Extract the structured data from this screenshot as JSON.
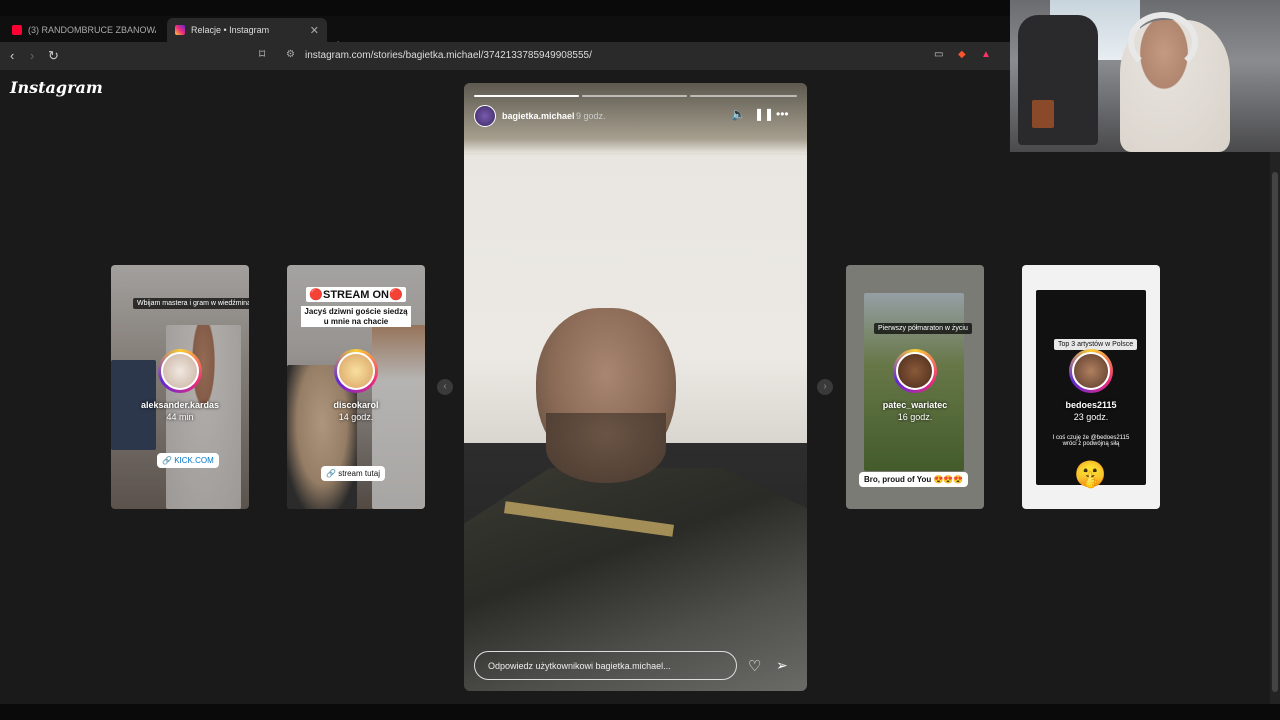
{
  "browser": {
    "tabs": [
      {
        "title": "(3) RANDOMBRUCE ZBANOWANY! Il",
        "favicon_color": "#ff0033"
      },
      {
        "title": "Relacje • Instagram",
        "favicon_color": "#e1306c"
      }
    ],
    "new_tab": "+",
    "url": "instagram.com/stories/bagietka.michael/3742133785949908555/"
  },
  "instagram": {
    "logo": "Instagram"
  },
  "main_story": {
    "username": "bagietka.michael",
    "time_ago": "9 godz.",
    "segments": 3,
    "reply_placeholder": "Odpowiedz użytkownikowi bagietka.michael..."
  },
  "side_stories": [
    {
      "username": "aleksander.kardas",
      "time_ago": "44 min",
      "sticker": "Wbijam mastera i gram w wiedźmina 3",
      "link": "KICK.COM"
    },
    {
      "username": "discokarol",
      "time_ago": "14 godz.",
      "title": "STREAM ON",
      "subtitle": "Jacyś dziwni goście siedzą u mnie na chacie",
      "link": "stream tutaj"
    },
    {
      "username": "patec_wariatec",
      "time_ago": "16 godz.",
      "sticker": "Pierwszy półmaraton w życiu",
      "caption": "Bro, proud of You 😍😍😍"
    },
    {
      "username": "bedoes2115",
      "time_ago": "23 godz.",
      "sticker": "Top 3 artystów w Polsce",
      "caption": "I coś czuję że @bedoes2115 wróci z podwójną siłą"
    }
  ]
}
